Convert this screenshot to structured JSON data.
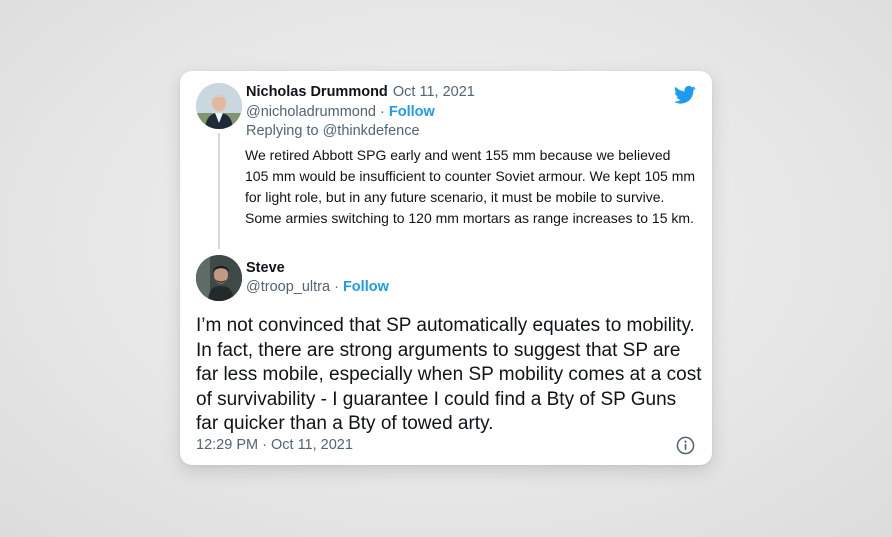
{
  "colors": {
    "accent": "#1d9bf0",
    "muted": "#536471",
    "text": "#0f1419",
    "line": "#cfd9de"
  },
  "icons": {
    "brand": "twitter-bird-icon",
    "info": "info-circle-icon"
  },
  "reply_tweet": {
    "name": "Nicholas Drummond",
    "separator": "·",
    "date": "Oct 11, 2021",
    "handle": "@nicholadrummond",
    "follow": "Follow",
    "replying_prefix": "Replying to ",
    "replying_to": "@thinkdefence",
    "text": "We retired Abbott SPG early and went 155 mm because we believed 105 mm would be insufficient to counter Soviet armour. We kept 105 mm for light role, but in any future scenario, it must be mobile to survive. Some armies switching to 120 mm mortars as range increases to 15 km."
  },
  "main_tweet": {
    "name": "Steve",
    "handle": "@troop_ultra",
    "separator": "·",
    "follow": "Follow",
    "text": "I’m not convinced that SP automatically equates to mobility. In fact, there are strong arguments to suggest that SP are far less mobile, especially when SP mobility comes at a cost of survivability - I guarantee I could find a Bty of SP Guns far quicker than a Bty of towed arty.",
    "time": "12:29 PM",
    "date": "Oct 11, 2021"
  }
}
